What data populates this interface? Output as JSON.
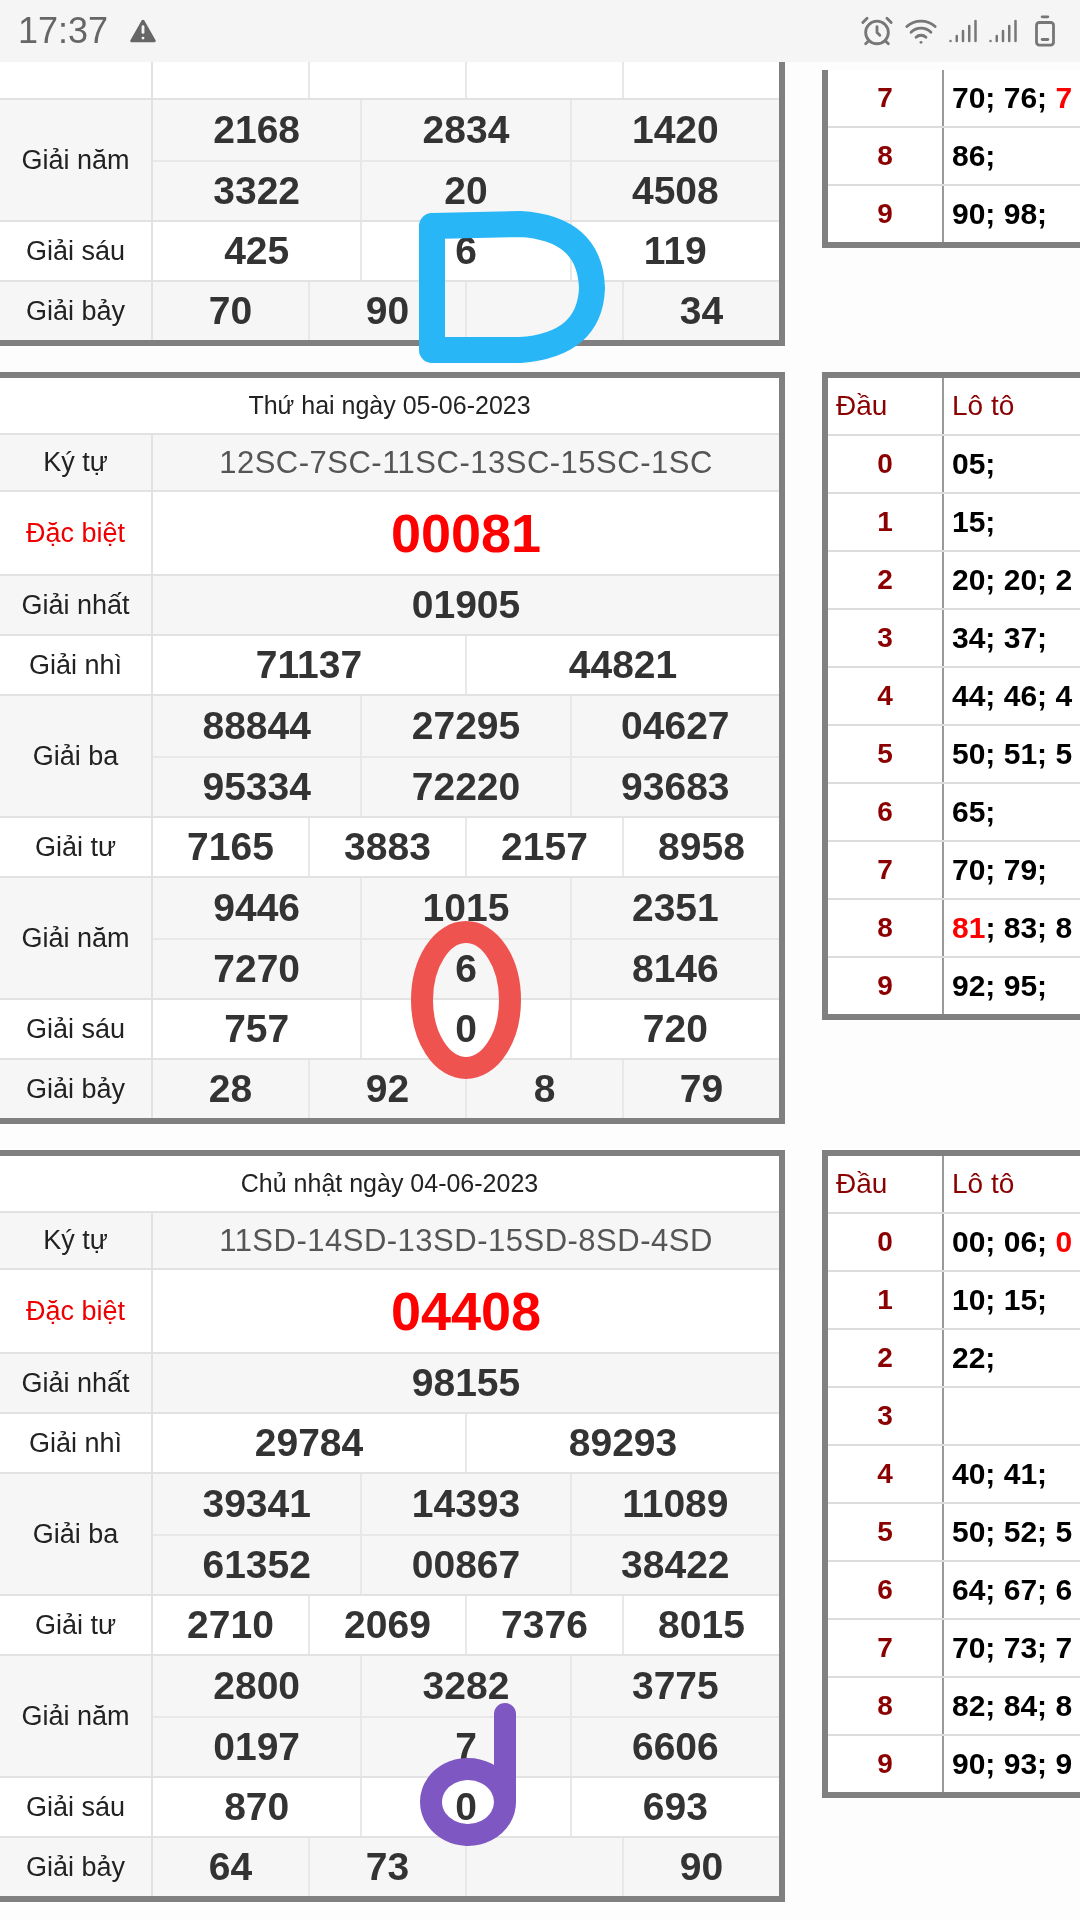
{
  "status_bar": {
    "time": "17:37"
  },
  "sections": [
    {
      "rows": [
        {
          "kind": "prize",
          "label": "Giải năm",
          "lines": [
            [
              "2168",
              "2834",
              "1420"
            ],
            [
              "3322",
              "20",
              "4508"
            ]
          ]
        },
        {
          "kind": "prize",
          "label": "Giải sáu",
          "lines": [
            [
              "425",
              "6",
              "119"
            ]
          ]
        },
        {
          "kind": "prize",
          "label": "Giải bảy",
          "lines": [
            [
              "70",
              "90",
              {
                "kind": "covered"
              },
              "34"
            ]
          ]
        }
      ],
      "loto": {
        "rows": [
          {
            "head": "7",
            "parts": [
              {
                "text": "70; 76; ",
                "special": false
              },
              {
                "text": "7",
                "special": true
              }
            ]
          },
          {
            "head": "8",
            "parts": [
              {
                "text": "86;",
                "special": false
              }
            ]
          },
          {
            "head": "9",
            "parts": [
              {
                "text": "90; 98;",
                "special": false
              }
            ]
          }
        ]
      },
      "scribble": {
        "kind": "loop",
        "color": "#29b6f6"
      }
    },
    {
      "rows": [
        {
          "kind": "title",
          "text": "Thứ hai ngày 05-06-2023"
        },
        {
          "kind": "code",
          "label": "Ký tự",
          "text": "12SC-7SC-11SC-13SC-15SC-1SC"
        },
        {
          "kind": "special",
          "label": "Đặc biệt",
          "text": "00081"
        },
        {
          "kind": "prize",
          "label": "Giải nhất",
          "lines": [
            [
              "01905"
            ]
          ]
        },
        {
          "kind": "prize",
          "label": "Giải nhì",
          "lines": [
            [
              "71137",
              "44821"
            ]
          ]
        },
        {
          "kind": "prize",
          "label": "Giải ba",
          "lines": [
            [
              "88844",
              "27295",
              "04627"
            ],
            [
              "95334",
              "72220",
              "93683"
            ]
          ]
        },
        {
          "kind": "prize",
          "label": "Giải tư",
          "lines": [
            [
              "7165",
              "3883",
              "2157",
              "8958"
            ]
          ]
        },
        {
          "kind": "prize",
          "label": "Giải năm",
          "lines": [
            [
              "9446",
              "1015",
              "2351"
            ],
            [
              "7270",
              "6",
              "8146"
            ]
          ]
        },
        {
          "kind": "prize",
          "label": "Giải sáu",
          "lines": [
            [
              "757",
              "0",
              "720"
            ]
          ]
        },
        {
          "kind": "prize",
          "label": "Giải bảy",
          "lines": [
            [
              "28",
              "92",
              "8",
              "79"
            ]
          ]
        }
      ],
      "loto": {
        "header": {
          "head": "Đầu",
          "numbers": "Lô tô"
        },
        "rows": [
          {
            "head": "0",
            "parts": [
              {
                "text": "05;",
                "special": false
              }
            ]
          },
          {
            "head": "1",
            "parts": [
              {
                "text": "15;",
                "special": false
              }
            ]
          },
          {
            "head": "2",
            "parts": [
              {
                "text": "20; 20; 2",
                "special": false
              }
            ]
          },
          {
            "head": "3",
            "parts": [
              {
                "text": "34; 37;",
                "special": false
              }
            ]
          },
          {
            "head": "4",
            "parts": [
              {
                "text": "44; 46; 4",
                "special": false
              }
            ]
          },
          {
            "head": "5",
            "parts": [
              {
                "text": "50; 51; 5",
                "special": false
              }
            ]
          },
          {
            "head": "6",
            "parts": [
              {
                "text": "65;",
                "special": false
              }
            ]
          },
          {
            "head": "7",
            "parts": [
              {
                "text": "70; 79;",
                "special": false
              }
            ]
          },
          {
            "head": "8",
            "parts": [
              {
                "text": "81",
                "special": true
              },
              {
                "text": "; 83; 8",
                "special": false
              }
            ]
          },
          {
            "head": "9",
            "parts": [
              {
                "text": "92; 95;",
                "special": false
              }
            ]
          }
        ]
      },
      "scribble": {
        "kind": "ring",
        "color": "#ef5350"
      }
    },
    {
      "rows": [
        {
          "kind": "title",
          "text": "Chủ nhật ngày 04-06-2023"
        },
        {
          "kind": "code",
          "label": "Ký tự",
          "text": "11SD-14SD-13SD-15SD-8SD-4SD"
        },
        {
          "kind": "special",
          "label": "Đặc biệt",
          "text": "04408"
        },
        {
          "kind": "prize",
          "label": "Giải nhất",
          "lines": [
            [
              "98155"
            ]
          ]
        },
        {
          "kind": "prize",
          "label": "Giải nhì",
          "lines": [
            [
              "29784",
              "89293"
            ]
          ]
        },
        {
          "kind": "prize",
          "label": "Giải ba",
          "lines": [
            [
              "39341",
              "14393",
              "11089"
            ],
            [
              "61352",
              "00867",
              "38422"
            ]
          ]
        },
        {
          "kind": "prize",
          "label": "Giải tư",
          "lines": [
            [
              "2710",
              "2069",
              "7376",
              "8015"
            ]
          ]
        },
        {
          "kind": "prize",
          "label": "Giải năm",
          "lines": [
            [
              "2800",
              "3282",
              "3775"
            ],
            [
              "0197",
              "7",
              "6606"
            ]
          ]
        },
        {
          "kind": "prize",
          "label": "Giải sáu",
          "lines": [
            [
              "870",
              "0",
              "693"
            ]
          ]
        },
        {
          "kind": "prize",
          "label": "Giải bảy",
          "lines": [
            [
              "64",
              "73",
              {
                "kind": "covered"
              },
              "90"
            ]
          ]
        }
      ],
      "loto": {
        "header": {
          "head": "Đầu",
          "numbers": "Lô tô"
        },
        "rows": [
          {
            "head": "0",
            "parts": [
              {
                "text": "00; 06; ",
                "special": false
              },
              {
                "text": "0",
                "special": true
              }
            ]
          },
          {
            "head": "1",
            "parts": [
              {
                "text": "10; 15;",
                "special": false
              }
            ]
          },
          {
            "head": "2",
            "parts": [
              {
                "text": "22;",
                "special": false
              }
            ]
          },
          {
            "head": "3"
          },
          {
            "head": "4",
            "parts": [
              {
                "text": "40; 41;",
                "special": false
              }
            ]
          },
          {
            "head": "5",
            "parts": [
              {
                "text": "50; 52; 5",
                "special": false
              }
            ]
          },
          {
            "head": "6",
            "parts": [
              {
                "text": "64; 67; 6",
                "special": false
              }
            ]
          },
          {
            "head": "7",
            "parts": [
              {
                "text": "70; 73; 7",
                "special": false
              }
            ]
          },
          {
            "head": "8",
            "parts": [
              {
                "text": "82; 84; 8",
                "special": false
              }
            ]
          },
          {
            "head": "9",
            "parts": [
              {
                "text": "90; 93; 9",
                "special": false
              }
            ]
          }
        ]
      },
      "scribble": {
        "kind": "stem",
        "color": "#7e57c2"
      }
    }
  ]
}
